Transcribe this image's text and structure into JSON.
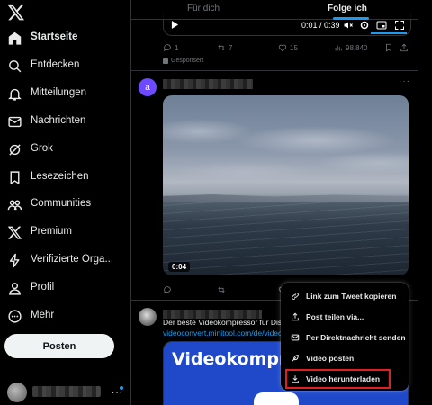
{
  "sidebar": {
    "items": [
      {
        "label": "Startseite",
        "icon": "home-icon"
      },
      {
        "label": "Entdecken",
        "icon": "search-icon"
      },
      {
        "label": "Mitteilungen",
        "icon": "bell-icon"
      },
      {
        "label": "Nachrichten",
        "icon": "mail-icon"
      },
      {
        "label": "Grok",
        "icon": "grok-icon"
      },
      {
        "label": "Lesezeichen",
        "icon": "bookmark-icon"
      },
      {
        "label": "Communities",
        "icon": "communities-icon"
      },
      {
        "label": "Premium",
        "icon": "x-logo-icon"
      },
      {
        "label": "Verifizierte Orga...",
        "icon": "lightning-icon"
      },
      {
        "label": "Profil",
        "icon": "person-icon"
      },
      {
        "label": "Mehr",
        "icon": "more-circle-icon"
      }
    ],
    "post_button": "Posten",
    "account_more": "···"
  },
  "tabs": {
    "for_you": "Für dich",
    "following": "Folge ich"
  },
  "post1": {
    "video_time": "0:01 / 0:39",
    "replies": "1",
    "reposts": "7",
    "likes": "15",
    "views": "98.840",
    "sponsored": "Gesponsert"
  },
  "post2": {
    "avatar_letter": "a",
    "more": "···",
    "duration": "0:04"
  },
  "post3": {
    "text": "Der beste Videokompressor für Disco",
    "link": "videoconvert.minitool.com/de/video-c",
    "card_title": "Videokompress"
  },
  "menu": {
    "items": [
      {
        "label": "Link zum Tweet kopieren",
        "icon": "link-icon"
      },
      {
        "label": "Post teilen via...",
        "icon": "share-icon"
      },
      {
        "label": "Per Direktnachricht senden",
        "icon": "mail-icon"
      },
      {
        "label": "Video posten",
        "icon": "feather-icon"
      },
      {
        "label": "Video herunterladen",
        "icon": "download-icon"
      }
    ]
  },
  "colors": {
    "accent": "#1d9bf0",
    "highlight": "#e02020",
    "background": "#000000"
  }
}
